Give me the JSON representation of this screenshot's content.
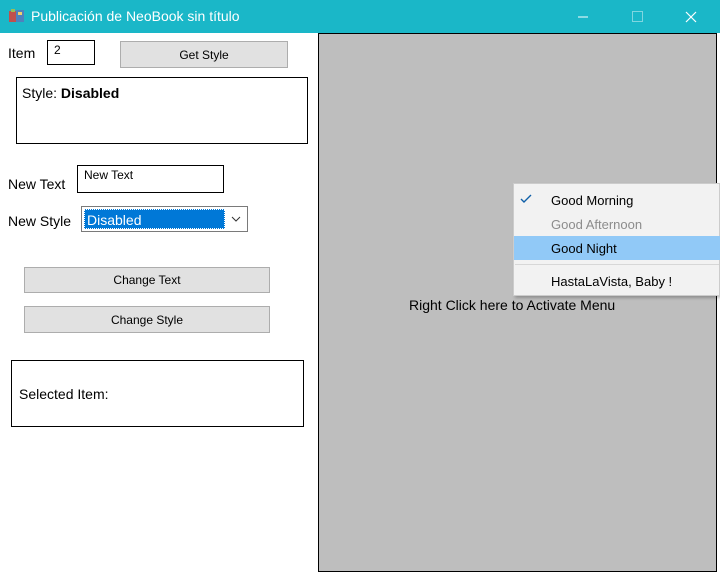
{
  "window": {
    "title": "Publicación de NeoBook sin título",
    "icon": "neobook-app-icon",
    "controls": [
      "minimize-icon",
      "maximize-icon",
      "close-icon"
    ]
  },
  "left": {
    "item_label": "Item",
    "item_value": "2",
    "get_style_button": "Get Style",
    "style_box": {
      "prefix": "Style:",
      "value": "Disabled"
    },
    "new_text_label": "New Text",
    "new_text_value": "New Text",
    "new_style_label": "New Style",
    "new_style_selected": "Disabled",
    "change_text_button": "Change Text",
    "change_style_button": "Change Style",
    "selected_item_label": "Selected Item:"
  },
  "right_panel": {
    "label": "Right Click here to Activate Menu"
  },
  "context_menu": {
    "items": [
      {
        "label": "Good Morning",
        "checked": true,
        "state": "normal"
      },
      {
        "label": "Good Afternoon",
        "checked": false,
        "state": "disabled"
      },
      {
        "label": "Good Night",
        "checked": false,
        "state": "highlighted"
      },
      {
        "label": "HastaLaVista, Baby !",
        "checked": false,
        "state": "normal"
      }
    ]
  },
  "colors": {
    "titlebar": "#1ab7c8",
    "panel": "#bebebe",
    "menu_highlight": "#91c9f7",
    "select_highlight": "#0078d7"
  }
}
